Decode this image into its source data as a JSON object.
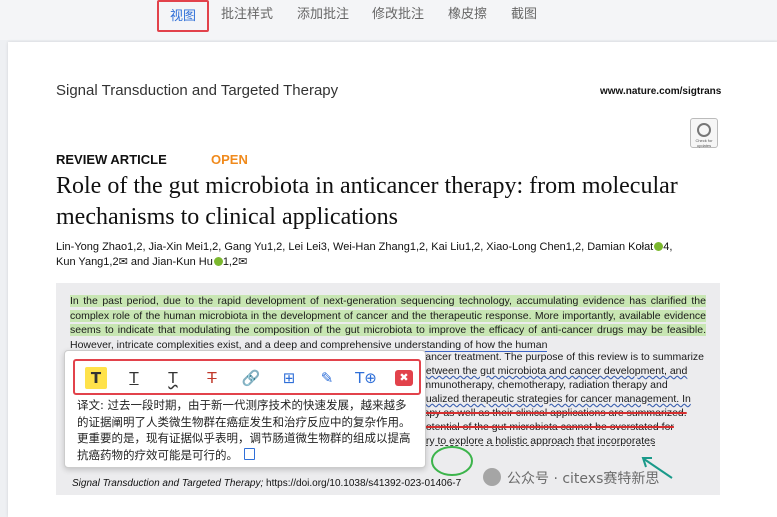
{
  "toolbar": {
    "tabs": [
      "视图",
      "批注样式",
      "添加批注",
      "修改批注",
      "橡皮擦",
      "截图"
    ],
    "active_tab": "视图"
  },
  "paper": {
    "journal": "Signal Transduction and Targeted Therapy",
    "url": "www.nature.com/sigtrans",
    "badge": "Check for updates",
    "type": "REVIEW ARTICLE",
    "access": "OPEN",
    "title": "Role of the gut microbiota in anticancer therapy: from molecular mechanisms to clinical applications",
    "authors_line1": "Lin-Yong Zhao1,2, Jia-Xin Mei1,2, Gang Yu1,2, Lei Lei3, Wei-Han Zhang1,2, Kai Liu1,2, Xiao-Long Chen1,2, Damian Kołat",
    "authors_line1_end": "4,",
    "authors_line2": "Kun Yang1,2✉ and Jian-Kun Hu",
    "authors_line2_end": "1,2✉",
    "abstract_highlighted": "In the past period, due to the rapid development of next-generation sequencing technology, accumulating evidence has clarified the complex role of the human microbiota in the development of cancer and the therapeutic response. More importantly, available evidence seems to indicate that modulating the composition of the gut microbiota to improve the efficacy of anti-cancer drugs may be feasible.",
    "abstract_underlined": "However, intricate complexities exist, and a deep and comprehensive understanding of how the human",
    "behind_lines": [
      "cancer treatment. The purpose of this review is to summarize",
      "between the gut microbiota and cancer development, and",
      "immunotherapy, chemotherapy, radiation therapy and",
      "dualized therapeutic strategies for cancer management. In",
      "rapy as well as their clinical applications are summarized.",
      "potential of the gut microbiota cannot be overstated for",
      "ary to explore a holistic approach that incorporates"
    ],
    "citation_journal": "Signal Transduction and Targeted Therapy;",
    "citation_doi": "https://doi.org/10.1038/s41392-023-01406-7"
  },
  "popup": {
    "translation": "译文: 过去一段时期，由于新一代测序技术的快速发展，越来越多的证据阐明了人类微生物群在癌症发生和治疗反应中的复杂作用。更重要的是，现有证据似乎表明，调节肠道微生物群的组成以提高抗癌药物的疗效可能是可行的。",
    "tools": [
      "T",
      "T",
      "T",
      "T",
      "link",
      "add-note",
      "edit",
      "text-add",
      "delete"
    ]
  },
  "watermark": "公众号 · citexs赛特新思",
  "colors": {
    "accent": "#2f6fd8",
    "highlight": "#c8e6b3",
    "marker": "#e2424b",
    "open": "#f08a1c"
  }
}
